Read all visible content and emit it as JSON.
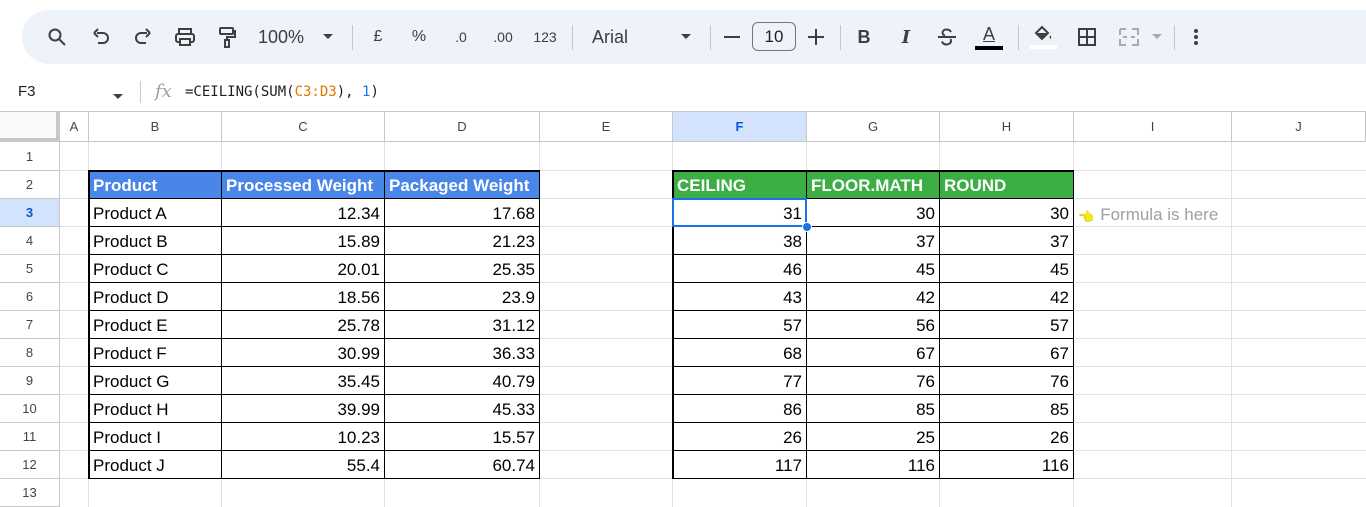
{
  "toolbar": {
    "zoom": "100%",
    "currency": "£",
    "percent": "%",
    "dec_decrease": ".0",
    "dec_increase": ".00",
    "number_format": "123",
    "font": "Arial",
    "font_size": "10",
    "bold": "B",
    "italic": "I",
    "text_color_letter": "A"
  },
  "formula_bar": {
    "cell_ref": "F3",
    "fx": "fx",
    "formula_prefix": "=CEILING(SUM(",
    "formula_ref": "C3:D3",
    "formula_mid": "), ",
    "formula_num": "1",
    "formula_suffix": ")"
  },
  "columns": [
    "A",
    "B",
    "C",
    "D",
    "E",
    "F",
    "G",
    "H",
    "I",
    "J"
  ],
  "rows": [
    "1",
    "2",
    "3",
    "4",
    "5",
    "6",
    "7",
    "8",
    "9",
    "10",
    "11",
    "12",
    "13"
  ],
  "table1": {
    "headers": [
      "Product",
      "Processed Weight",
      "Packaged Weight"
    ],
    "rows": [
      [
        "Product A",
        "12.34",
        "17.68"
      ],
      [
        "Product B",
        "15.89",
        "21.23"
      ],
      [
        "Product C",
        "20.01",
        "25.35"
      ],
      [
        "Product D",
        "18.56",
        "23.9"
      ],
      [
        "Product E",
        "25.78",
        "31.12"
      ],
      [
        "Product F",
        "30.99",
        "36.33"
      ],
      [
        "Product G",
        "35.45",
        "40.79"
      ],
      [
        "Product H",
        "39.99",
        "45.33"
      ],
      [
        "Product I",
        "10.23",
        "15.57"
      ],
      [
        "Product J",
        "55.4",
        "60.74"
      ]
    ]
  },
  "table2": {
    "headers": [
      "CEILING",
      "FLOOR.MATH",
      "ROUND"
    ],
    "rows": [
      [
        "31",
        "30",
        "30"
      ],
      [
        "38",
        "37",
        "37"
      ],
      [
        "46",
        "45",
        "45"
      ],
      [
        "43",
        "42",
        "42"
      ],
      [
        "57",
        "56",
        "57"
      ],
      [
        "68",
        "67",
        "67"
      ],
      [
        "77",
        "76",
        "76"
      ],
      [
        "86",
        "85",
        "85"
      ],
      [
        "26",
        "25",
        "26"
      ],
      [
        "117",
        "116",
        "116"
      ]
    ]
  },
  "note": {
    "emoji": "👈",
    "text": "Formula is here"
  },
  "colors": {
    "header_blue": "#4a86e8",
    "header_green": "#3dae45",
    "selection": "#1a73e8"
  }
}
